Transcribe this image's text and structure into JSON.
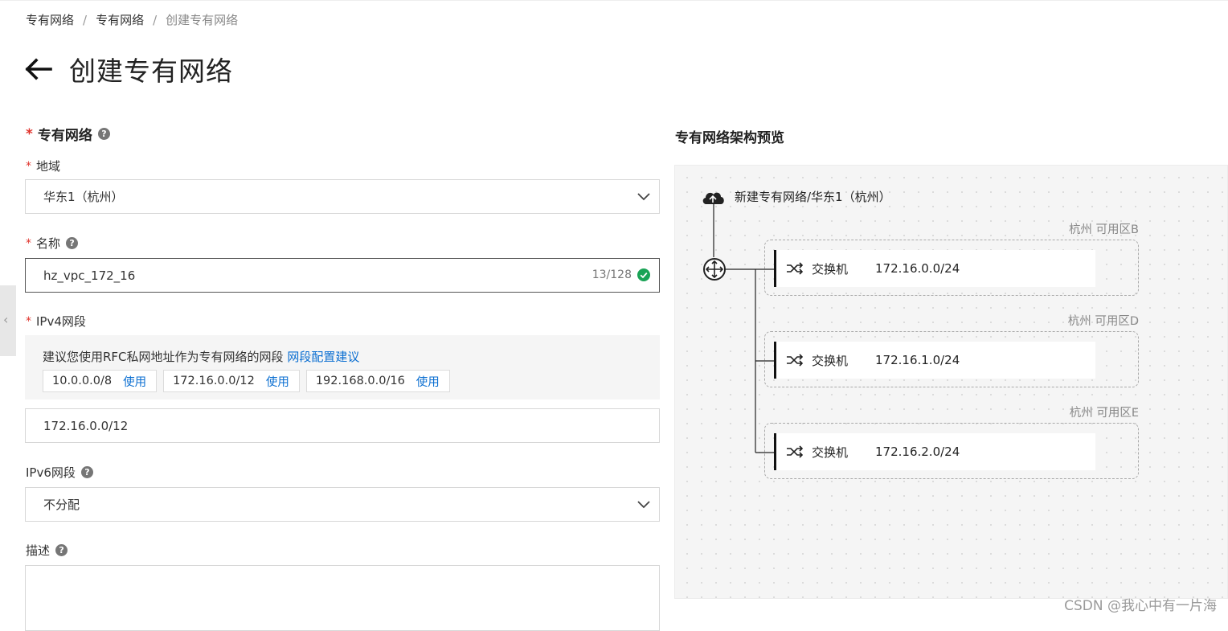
{
  "breadcrumb": {
    "items": [
      "专有网络",
      "专有网络"
    ],
    "current": "创建专有网络",
    "separator": "/"
  },
  "page": {
    "title": "创建专有网络"
  },
  "form": {
    "section_title": "专有网络",
    "region": {
      "label": "地域",
      "value": "华东1（杭州）"
    },
    "name": {
      "label": "名称",
      "value": "hz_vpc_172_16",
      "counter": "13/128"
    },
    "ipv4": {
      "label": "IPv4网段",
      "hint": "建议您使用RFC私网地址作为专有网络的网段",
      "hint_link": "网段配置建议",
      "chips": [
        {
          "cidr": "10.0.0.0/8",
          "action": "使用"
        },
        {
          "cidr": "172.16.0.0/12",
          "action": "使用"
        },
        {
          "cidr": "192.168.0.0/16",
          "action": "使用"
        }
      ],
      "value": "172.16.0.0/12"
    },
    "ipv6": {
      "label": "IPv6网段",
      "value": "不分配"
    },
    "description": {
      "label": "描述",
      "value": ""
    }
  },
  "preview": {
    "title": "专有网络架构预览",
    "vpc_label": "新建专有网络/华东1（杭州）",
    "zones": [
      {
        "zone": "杭州 可用区B",
        "switch_name": "交换机",
        "cidr": "172.16.0.0/24"
      },
      {
        "zone": "杭州 可用区D",
        "switch_name": "交换机",
        "cidr": "172.16.1.0/24"
      },
      {
        "zone": "杭州 可用区E",
        "switch_name": "交换机",
        "cidr": "172.16.2.0/24"
      }
    ]
  },
  "colors": {
    "link": "#0a6ed1",
    "required": "#e0322b",
    "success": "#1aa356"
  },
  "icons": [
    "back-arrow-icon",
    "help-icon",
    "chevron-down-icon",
    "check-circle-icon",
    "cloud-icon",
    "router-icon",
    "switch-icon",
    "chevron-left-icon"
  ],
  "watermark": "CSDN @我心中有一片海"
}
